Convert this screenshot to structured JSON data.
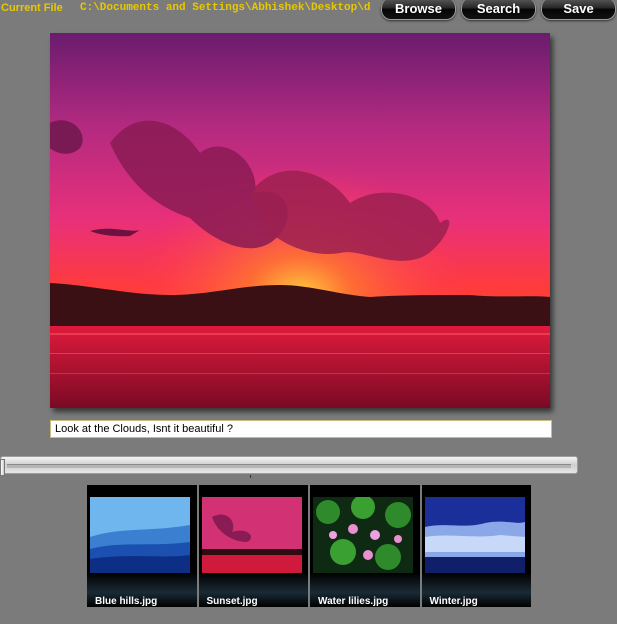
{
  "toolbar": {
    "current_file_label": "Current File",
    "current_file_path": "C:\\Documents and Settings\\Abhishek\\Desktop\\d.p",
    "browse_label": "Browse",
    "search_label": "Search",
    "save_label": "Save"
  },
  "viewer": {
    "caption": "Look at the Clouds, Isnt it beautiful ?"
  },
  "slider": {
    "value": 0
  },
  "thumbnails": [
    {
      "name": "Blue hills.jpg",
      "icon": "blue-hills-image"
    },
    {
      "name": "Sunset.jpg",
      "icon": "sunset-image"
    },
    {
      "name": "Water lilies.jpg",
      "icon": "water-lilies-image"
    },
    {
      "name": "Winter.jpg",
      "icon": "winter-image"
    }
  ],
  "colors": {
    "label_yellow": "#e8c800",
    "background": "#7b7b7b"
  }
}
